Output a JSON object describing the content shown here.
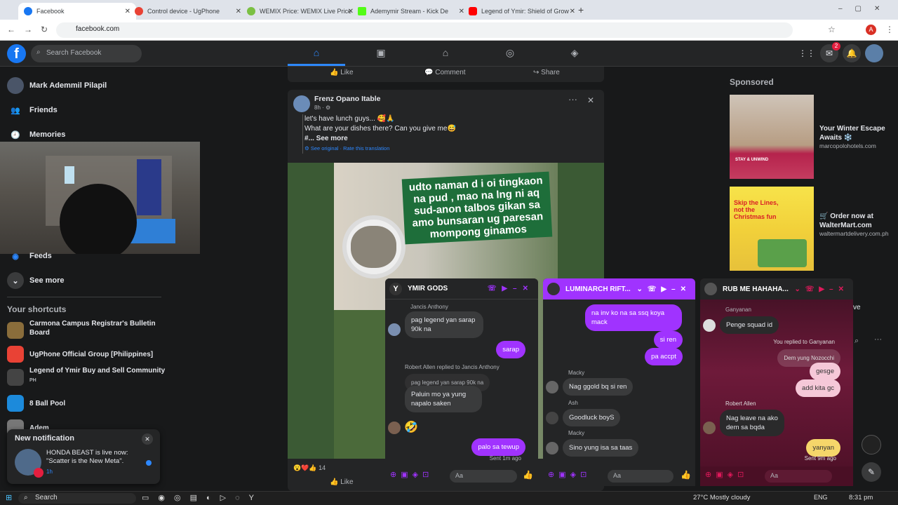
{
  "browser": {
    "tabs": [
      {
        "title": "Facebook",
        "active": true,
        "color": "#1877f2"
      },
      {
        "title": "Control device - UgPhone",
        "active": false,
        "color": "#e94235"
      },
      {
        "title": "WEMIX Price: WEMIX Live Price",
        "active": false,
        "color": "#7bc043"
      },
      {
        "title": "Ademymir Stream - Kick De",
        "active": false,
        "color": "#53fc18"
      },
      {
        "title": "Legend of Ymir: Shield of Grow",
        "active": false,
        "color": "#ff0000"
      }
    ],
    "url": "facebook.com"
  },
  "header": {
    "search_placeholder": "Search Facebook",
    "messenger_badge": "2",
    "profile_initial": "A"
  },
  "sidebar": {
    "profile_name": "Mark Ademmil Pilapil",
    "items": [
      {
        "label": "Friends",
        "icon": "friends-icon"
      },
      {
        "label": "Memories",
        "icon": "memories-icon"
      },
      {
        "label": "Feeds",
        "icon": "feeds-icon"
      },
      {
        "label": "See more",
        "icon": "chevron-down-icon"
      }
    ],
    "shortcuts_title": "Your shortcuts",
    "shortcuts": [
      {
        "label": "Carmona Campus Registrar's Bulletin Board",
        "color": "#8a6d3b"
      },
      {
        "label": "UgPhone Official Group [Philippines]",
        "color": "#e94235"
      },
      {
        "label": "Legend of Ymir Buy and Sell Community",
        "sub": "PH",
        "color": "#444"
      },
      {
        "label": "8 Ball Pool",
        "color": "#1c8adb"
      },
      {
        "label": "Adem",
        "color": "#777"
      }
    ]
  },
  "notification": {
    "title": "New notification",
    "text": "HONDA BEAST is live now: \"Scatter is the New Meta\".",
    "time": "1h"
  },
  "feed": {
    "prev_actions": {
      "like": "Like",
      "comment": "Comment",
      "share": "Share"
    },
    "post": {
      "author": "Frenz Opano Itable",
      "time": "8h",
      "line1": "let's have lunch guys... 🥰🙏",
      "line2": "What are your dishes there? Can you give me😅",
      "see_more": "#... See more",
      "translation": "See original · Rate this translation",
      "image_text": "udto naman d i oi tingkaon na pud , mao na lng ni aq sud-anon talbos gikan sa amo bunsaran ug paresan mompong ginamos",
      "reactions_count": "14",
      "like_label": "Like"
    }
  },
  "right": {
    "sponsored_title": "Sponsored",
    "ads": [
      {
        "title": "Your Winter Escape Awaits ❄️",
        "site": "marcopolohotels.com",
        "img_text": "STAY & UNWIND"
      },
      {
        "title": "🛒 Order now at WalterMart.com",
        "site": "waltermartdelivery.com.ph",
        "img_text": "Skip the Lines, not the Christmas fun"
      }
    ],
    "partial_label": "ve"
  },
  "chats": [
    {
      "name": "YMIR GODS",
      "accent": "#a033ff",
      "messages": [
        {
          "sender": "Jancis Anthony",
          "text": "pag legend yan sarap 90k na",
          "dir": "in"
        },
        {
          "text": "sarap",
          "dir": "out"
        },
        {
          "reply_note": "Robert Allen replied to Jancis Anthony",
          "quoted": "pag legend yan sarap 90k na",
          "text": "Paluin mo ya yung napalo saken",
          "dir": "in"
        },
        {
          "text": "palo sa tewup",
          "dir": "out",
          "status": "Sent 1m ago"
        }
      ],
      "input_placeholder": "Aa"
    },
    {
      "name": "LUMINARCH RIFT...",
      "accent": "#a033ff",
      "messages": [
        {
          "text": "na inv ko na sa ssq koya mack",
          "dir": "out"
        },
        {
          "text": "si ren",
          "dir": "out"
        },
        {
          "text": "pa accpt",
          "dir": "out"
        },
        {
          "sender": "Macky",
          "text": "Nag ggold bq si ren",
          "dir": "in"
        },
        {
          "sender": "Ash",
          "text": "Goodluck boyS",
          "dir": "in"
        },
        {
          "sender": "Macky",
          "text": "Sino yung isa sa taas",
          "dir": "in"
        }
      ],
      "input_placeholder": "Aa"
    },
    {
      "name": "RUB ME HAHAHA...",
      "accent": "#e0195b",
      "messages": [
        {
          "sender": "Ganyanan",
          "text": "Penge squad id",
          "dir": "in"
        },
        {
          "reply_note": "You replied to Ganyanan",
          "quoted": "Dem yung Nozocchi",
          "text": "gesge",
          "dir": "out"
        },
        {
          "text": "add kita gc",
          "dir": "out"
        },
        {
          "sender": "Robert Allen",
          "text": "Nag leave na ako dem sa bqda",
          "dir": "in"
        },
        {
          "text": "yanyan",
          "dir": "out",
          "status": "Sent 9m ago"
        }
      ],
      "input_placeholder": "Aa"
    }
  ],
  "taskbar": {
    "search": "Search",
    "weather": "27°C  Mostly cloudy",
    "lang": "ENG",
    "time": "8:31 pm"
  }
}
